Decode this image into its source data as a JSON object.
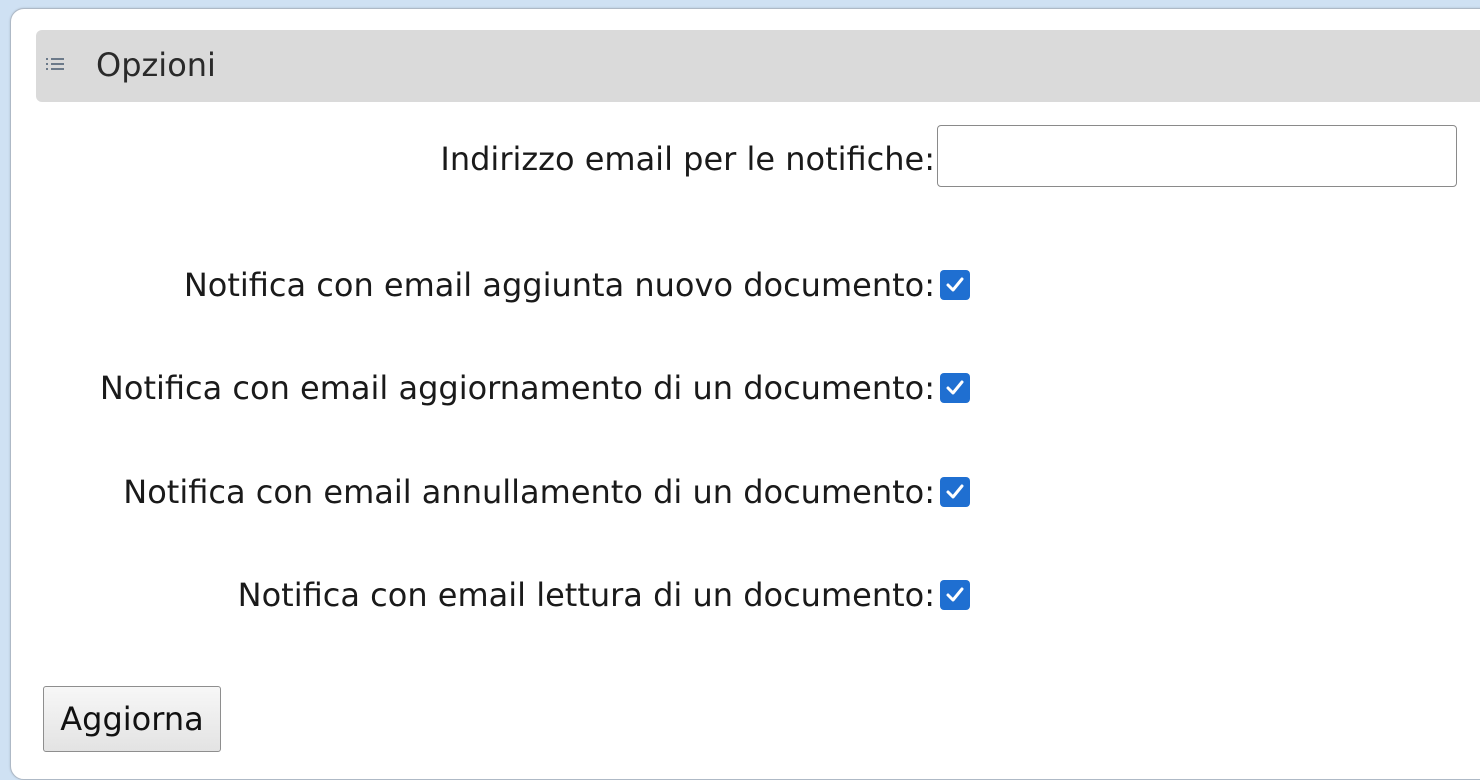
{
  "section": {
    "title": "Opzioni",
    "icon": "list-icon"
  },
  "email": {
    "label": "Indirizzo email per le notifiche:",
    "value": "",
    "placeholder": ""
  },
  "options": [
    {
      "label": "Notifica con email aggiunta nuovo documento:",
      "checked": true
    },
    {
      "label": "Notifica con email aggiornamento di un documento:",
      "checked": true
    },
    {
      "label": "Notifica con email annullamento di un documento:",
      "checked": true
    },
    {
      "label": "Notifica con email lettura di un documento:",
      "checked": true
    }
  ],
  "actions": {
    "update_label": "Aggiorna"
  },
  "colors": {
    "checkbox": "#1f6fd1",
    "header_bg": "#dadada",
    "page_bg": "#cfe1f3"
  }
}
